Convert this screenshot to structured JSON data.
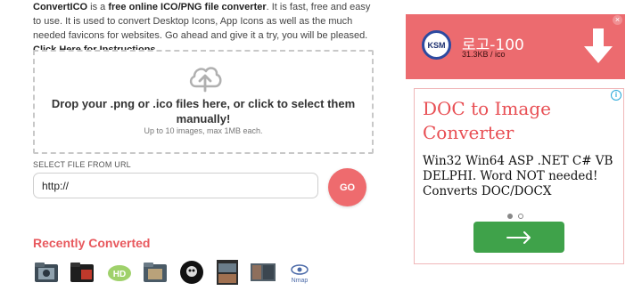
{
  "intro": {
    "brand": "ConvertICO",
    "text_1": " is a ",
    "bold_1": "free online ICO/PNG file converter",
    "text_2": ". It is fast, free and easy to use. It is used to convert Desktop Icons, App Icons as well as the much needed favicons for websites. Go ahead and give it a try, you will be pleased. ",
    "link": "Click Here for Instructions"
  },
  "dropzone": {
    "icon": "cloud-upload-icon",
    "main_text": "Drop your .png or .ico files here, or click to select them manually!",
    "sub_text": "Up to 10 images, max 1MB each."
  },
  "url_form": {
    "label": "SELECT FILE FROM URL",
    "value": "http://",
    "button_label": "GO"
  },
  "recent": {
    "title": "Recently Converted",
    "thumbnails": [
      "folder-icon-dark",
      "folder-icon-black",
      "hd-logo-icon",
      "folder-icon-movie",
      "skull-emblem-icon",
      "game-cover-icon",
      "photo-icon",
      "nmap-eye-icon"
    ]
  },
  "ad_banner": {
    "logo_text": "KSM",
    "title": "로고-100",
    "size": "31.3KB / ico",
    "download_icon": "download-arrow-icon",
    "close_icon": "close-icon",
    "bg_color": "#ec6b6f"
  },
  "ad_box": {
    "headline": "DOC to Image Converter",
    "body": "Win32 Win64 ASP .NET C# VB DELPHI. Word NOT needed! Converts DOC/DOCX",
    "info_icon": "info-icon",
    "cta_icon": "arrow-right-icon",
    "accent_color": "#e84e53",
    "cta_color": "#3fa24a"
  }
}
